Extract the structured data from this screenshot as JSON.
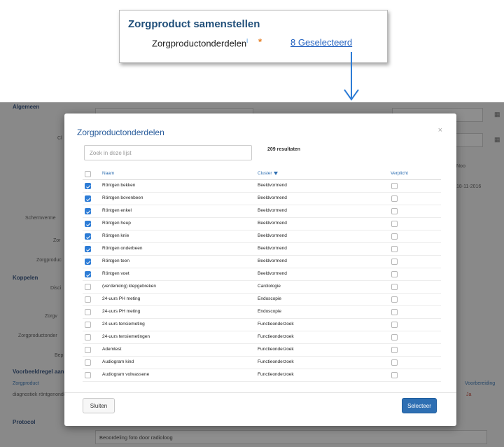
{
  "callout": {
    "title": "Zorgproduct samenstellen",
    "field_label": "Zorgproductonderdelen",
    "info_marker": "i",
    "required_marker": "*",
    "selected_link": "8 Geselecteerd"
  },
  "background": {
    "section_general": "Algemeen",
    "section_link": "Koppelen",
    "section_example": "Voorbeeldregel aanb",
    "section_protocol": "Protocol",
    "labels": [
      "Cl",
      "Schermverme",
      "Zor",
      "Zorgproduc",
      "Disci",
      "Zorgv",
      "Zorgproductonder",
      "Bep"
    ],
    "col_zorgproduct": "Zorgproduct",
    "row_value": "diagnostiek röntgenonde",
    "right_label": "Noo",
    "right_date": "18-11-2016",
    "right_col": "Voorbereiding",
    "right_value": "Ja",
    "bottom_text": "Beoordeling foto door radioloog",
    "calendar_icon": "calendar-icon"
  },
  "modal": {
    "title": "Zorgproductonderdelen",
    "close_label": "×",
    "search_placeholder": "Zoek in deze lijst",
    "result_count": "209 resultaten",
    "columns": {
      "naam": "Naam",
      "cluster": "Cluster",
      "verplicht": "Verplicht"
    },
    "rows": [
      {
        "naam": "Röntgen bekken",
        "cluster": "Beeldvormend",
        "selected": true,
        "verplicht": false
      },
      {
        "naam": "Röntgen bovenbeen",
        "cluster": "Beeldvormend",
        "selected": true,
        "verplicht": false
      },
      {
        "naam": "Röntgen enkel",
        "cluster": "Beeldvormend",
        "selected": true,
        "verplicht": false
      },
      {
        "naam": "Röntgen heup",
        "cluster": "Beeldvormend",
        "selected": true,
        "verplicht": false
      },
      {
        "naam": "Röntgen knie",
        "cluster": "Beeldvormend",
        "selected": true,
        "verplicht": false
      },
      {
        "naam": "Röntgen onderbeen",
        "cluster": "Beeldvormend",
        "selected": true,
        "verplicht": false
      },
      {
        "naam": "Röntgen teen",
        "cluster": "Beeldvormend",
        "selected": true,
        "verplicht": false
      },
      {
        "naam": "Röntgen voet",
        "cluster": "Beeldvormend",
        "selected": true,
        "verplicht": false
      },
      {
        "naam": "(verdenking) klepgebreken",
        "cluster": "Cardiologie",
        "selected": false,
        "verplicht": false
      },
      {
        "naam": "24-uurs PH meting",
        "cluster": "Endoscopie",
        "selected": false,
        "verplicht": false
      },
      {
        "naam": "24-uurs PH meting",
        "cluster": "Endoscopie",
        "selected": false,
        "verplicht": false
      },
      {
        "naam": "24-uurs tensiemeting",
        "cluster": "Functieonderzoek",
        "selected": false,
        "verplicht": false
      },
      {
        "naam": "24-uurs tensiemetingen",
        "cluster": "Functieonderzoek",
        "selected": false,
        "verplicht": false
      },
      {
        "naam": "Ademtest",
        "cluster": "Functieonderzoek",
        "selected": false,
        "verplicht": false
      },
      {
        "naam": "Audiogram kind",
        "cluster": "Functieonderzoek",
        "selected": false,
        "verplicht": false
      },
      {
        "naam": "Audiogram volwassene",
        "cluster": "Functieonderzoek",
        "selected": false,
        "verplicht": false
      }
    ],
    "close_button": "Sluiten",
    "select_button": "Selecteer"
  }
}
